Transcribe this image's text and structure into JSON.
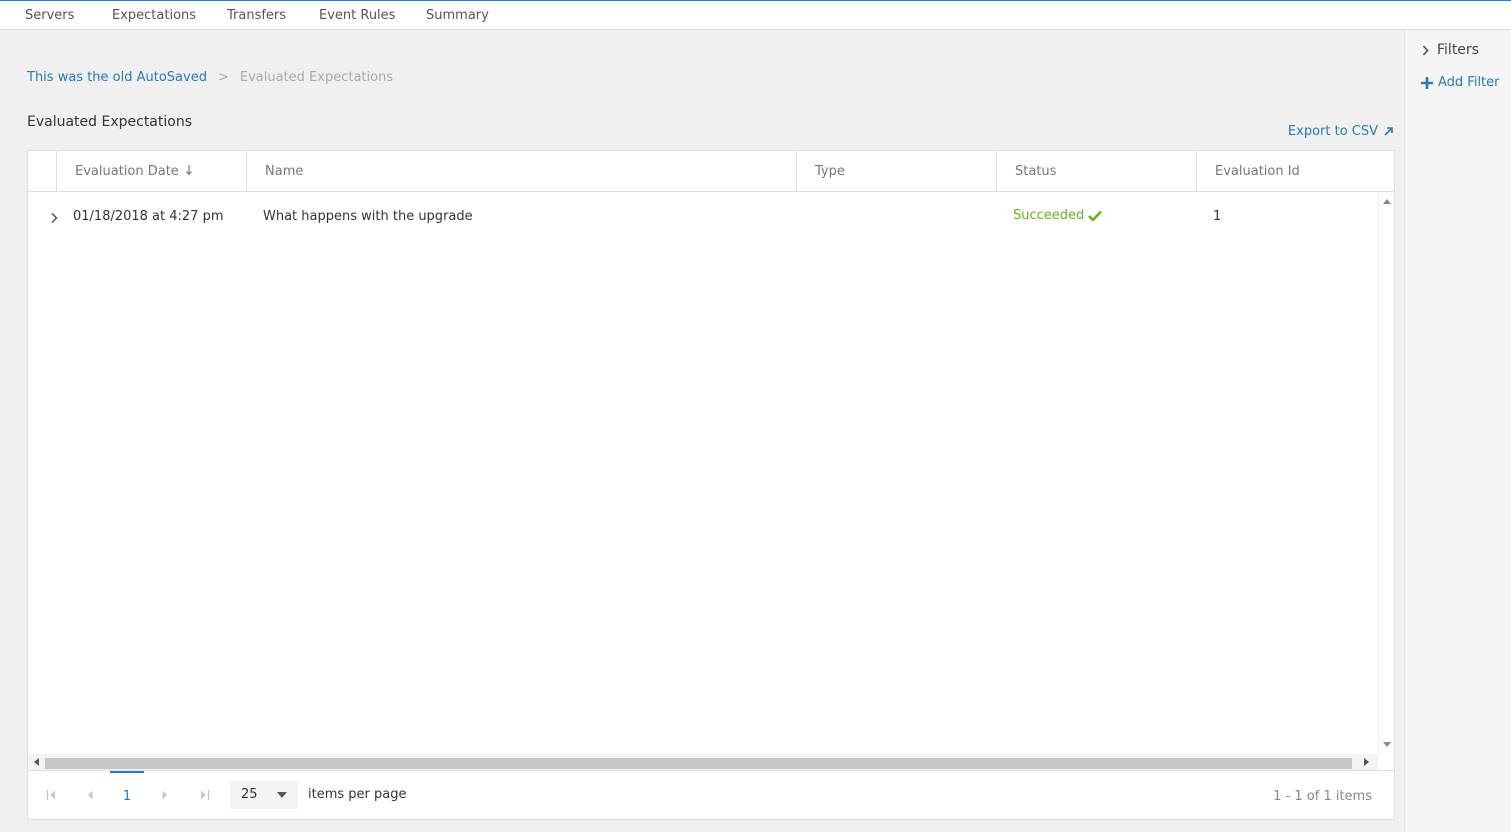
{
  "nav": {
    "tabs": [
      {
        "label": "Servers"
      },
      {
        "label": "Expectations"
      },
      {
        "label": "Transfers"
      },
      {
        "label": "Event Rules"
      },
      {
        "label": "Summary"
      }
    ]
  },
  "breadcrumb": {
    "parent": "This was the old AutoSaved",
    "separator": ">",
    "current": "Evaluated Expectations"
  },
  "page_title": "Evaluated Expectations",
  "export_label": "Export to CSV",
  "table": {
    "columns": [
      "Evaluation Date",
      "Name",
      "Type",
      "Status",
      "Evaluation Id"
    ],
    "sort_column": "Evaluation Date",
    "sort_direction": "descending",
    "rows": [
      {
        "evaluation_date": "01/18/2018 at 4:27 pm",
        "name": "What happens with the upgrade",
        "type": "",
        "status": "Succeeded",
        "evaluation_id": "1"
      }
    ]
  },
  "pager": {
    "current_page": "1",
    "page_size": "25",
    "page_size_label": "items per page",
    "info": "1 - 1 of 1 items"
  },
  "side_panel": {
    "filters_label": "Filters",
    "add_filter_label": "Add Filter"
  },
  "colors": {
    "accent": "#2a7ab8",
    "success": "#6ab023"
  }
}
